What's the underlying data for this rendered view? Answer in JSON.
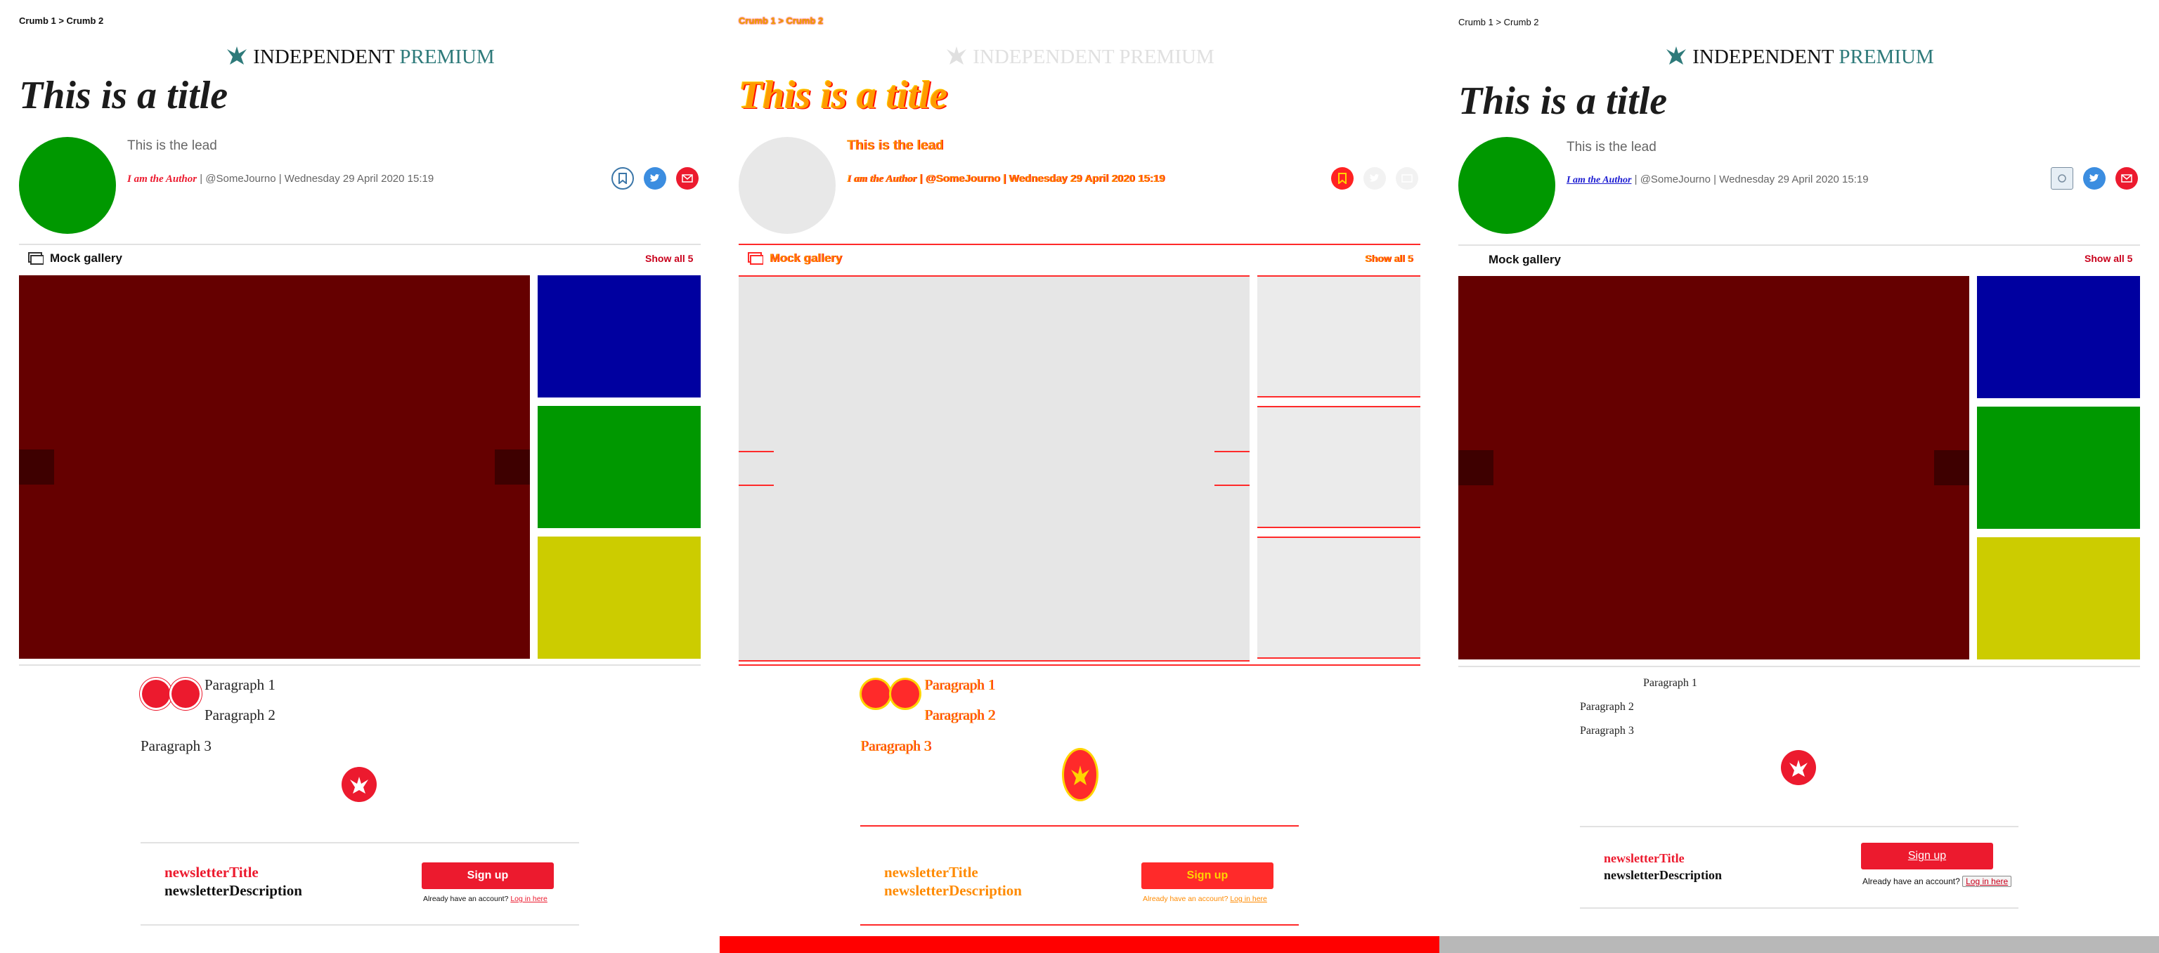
{
  "article": {
    "breadcrumb": "Crumb 1 > Crumb 2",
    "logo_main": "INDEPENDENT",
    "logo_premium": "PREMIUM",
    "title": "This is a title",
    "lead": "This is the lead",
    "author": "I am the Author",
    "byline_rest": " | @SomeJourno | Wednesday 29 April 2020 15:19",
    "byline_handle": "@SomeJourno",
    "byline_date": "Wednesday 29 April 2020 15:19",
    "gallery_title": "Mock gallery",
    "show_all": "Show all 5",
    "paragraphs": [
      "Paragraph 1",
      "Paragraph 2",
      "Paragraph 3"
    ],
    "newsletter_title": "newsletterTitle",
    "newsletter_description": "newsletterDescription",
    "signup_label": "Sign up",
    "account_text": "Already have an account?",
    "login_link": "Log in here"
  },
  "colors": {
    "brand_red": "#ec1a2e",
    "avatar_green": "#009800",
    "gallery_main": "#650000",
    "thumb_blue": "#0000a0",
    "thumb_green": "#009800",
    "thumb_yellow": "#cccc00",
    "premium_teal": "#2e7a7a",
    "diff_red": "#ff0000",
    "diff_grey": "#b8b8b8"
  },
  "icons": [
    "eagle-logo-icon",
    "bookmark-icon",
    "twitter-icon",
    "email-icon",
    "gallery-icon",
    "quote-icon",
    "eagle-badge-icon"
  ]
}
